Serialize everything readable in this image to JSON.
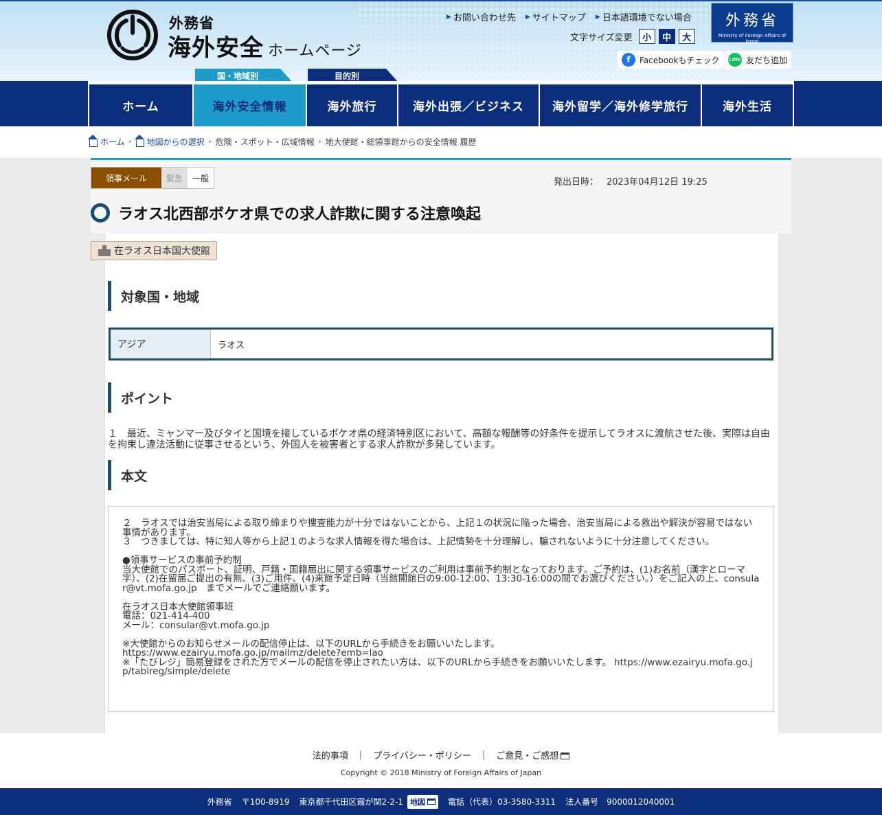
{
  "header": {
    "ministry": "外務省",
    "site_title": "海外安全",
    "site_title_sub": "ホームページ",
    "top_links": [
      "お問い合わせ先",
      "サイトマップ",
      "日本語環境でない場合"
    ],
    "font_size_label": "文字サイズ変更",
    "font_sizes": [
      "小",
      "中",
      "大"
    ],
    "font_size_selected": "中",
    "badge_jp": "外務省",
    "badge_en": "Ministry of Foreign Affairs of Japan",
    "facebook": "Facebookもチェック",
    "line": "友だち追加",
    "line_icon": "LINE",
    "tab_country": "国・地域別",
    "tab_purpose": "目的別"
  },
  "nav": [
    "ホーム",
    "海外安全情報",
    "海外旅行",
    "海外出張／ビジネス",
    "海外留学／海外修学旅行",
    "海外生活"
  ],
  "nav_active": "海外安全情報",
  "breadcrumb": {
    "home": "ホーム",
    "map": "地図からの選択",
    "spot": "危険・スポット・広域情報",
    "current": "地大使館・総領事館からの安全情報 履歴"
  },
  "article": {
    "mail_type": "領事メール",
    "urgent": "緊急",
    "general": "一般",
    "issued_label": "発出日時：",
    "issued_date": "2023年04月12日 19:25",
    "title": "ラオス北西部ボケオ県での求人詐欺に関する注意喚起",
    "embassy": "在ラオス日本国大使館"
  },
  "sections": {
    "target": "対象国・地域",
    "point": "ポイント",
    "body": "本文"
  },
  "target_area": {
    "region": "アジア",
    "country": "ラオス"
  },
  "point_text": "１　最近、ミャンマー及びタイと国境を接しているボケオ県の経済特別区において、高額な報酬等の好条件を提示してラオスに渡航させた後、実際は自由を拘束し違法活動に従事させるという、外国人を被害者とする求人詐欺が多発しています。",
  "body_text": {
    "p2": "２　ラオスでは治安当局による取り締まりや捜査能力が十分ではないことから、上記１の状況に陥った場合、治安当局による救出や解決が容易ではない事情があります。",
    "p3": "３　つきましては、特に知人等から上記１のような求人情報を得た場合は、上記情勢を十分理解し、騙されないように十分注意してください。",
    "reservation_title": "●領事サービスの事前予約制",
    "reservation_text": "当大使館でのパスポート、証明、戸籍・国籍届出に関する領事サービスのご利用は事前予約制となっております。ご予約は、(1)お名前（漢字とローマ字）、(2)在留届ご提出の有無、(3)ご用件、(4)来館予定日時（当館開館日の9:00-12:00、13:30-16:00の間でお選びください。）をご記入の上、consular@vt.mofa.go.jp　までメールでご連絡願います。",
    "contact_name": "在ラオス日本大使館領事班",
    "contact_tel": "電話：021-414-400",
    "contact_mail": "メール：consular@vt.mofa.go.jp",
    "stop_note": "※大使館からのお知らせメールの配信停止は、以下のURLから手続きをお願いいたします。",
    "stop_url": "https://www.ezairyu.mofa.go.jp/mailmz/delete?emb=lao",
    "tabireg_note": "※「たびレジ」簡易登録をされた方でメールの配信を停止されたい方は、以下のURLから手続きをお願いいたします。 https://www.ezairyu.mofa.go.jp/tabireg/simple/delete"
  },
  "footer": {
    "legal": "法的事項",
    "privacy": "プライバシー・ポリシー",
    "feedback": "ご意見・ご感想",
    "copyright": "Copyright © 2018 Ministry of Foreign Affairs of Japan",
    "org": "外務省",
    "postal": "〒100-8919",
    "address": "東京都千代田区霞が関2-2-1",
    "map": "地図",
    "phone": "電話（代表）03-3580-3311",
    "corp_no": "法人番号　9000012040001"
  },
  "colors": {
    "navy": "#0a2d7c",
    "cyan": "#1d9bc9",
    "heading_accent": "#1e4a6e",
    "mail_tag": "#8b4d00"
  }
}
